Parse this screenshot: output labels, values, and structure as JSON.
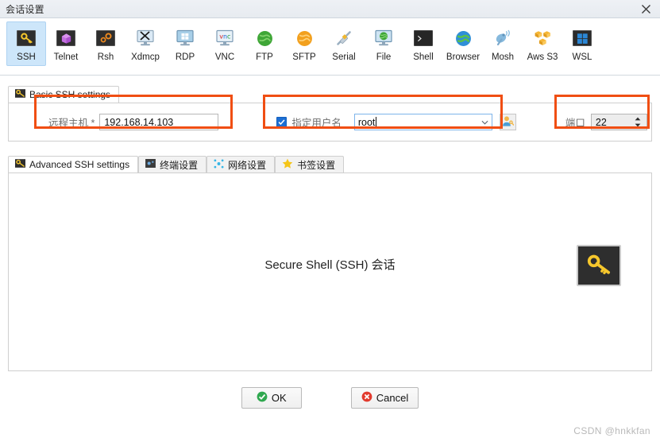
{
  "window": {
    "title": "会话设置",
    "close_icon": "close-icon"
  },
  "toolbar": {
    "items": [
      {
        "label": "SSH",
        "icon": "key-icon",
        "selected": true
      },
      {
        "label": "Telnet",
        "icon": "purple-cube-icon",
        "selected": false
      },
      {
        "label": "Rsh",
        "icon": "orange-gears-icon",
        "selected": false
      },
      {
        "label": "Xdmcp",
        "icon": "monitor-x-icon",
        "selected": false
      },
      {
        "label": "RDP",
        "icon": "monitor-windows-icon",
        "selected": false
      },
      {
        "label": "VNC",
        "icon": "monitor-vnc-icon",
        "selected": false
      },
      {
        "label": "FTP",
        "icon": "green-globe-icon",
        "selected": false
      },
      {
        "label": "SFTP",
        "icon": "orange-globe-icon",
        "selected": false
      },
      {
        "label": "Serial",
        "icon": "serial-cable-icon",
        "selected": false
      },
      {
        "label": "File",
        "icon": "monitor-globe-icon",
        "selected": false
      },
      {
        "label": "Shell",
        "icon": "terminal-icon",
        "selected": false
      },
      {
        "label": "Browser",
        "icon": "blue-globe-icon",
        "selected": false
      },
      {
        "label": "Mosh",
        "icon": "satellite-dish-icon",
        "selected": false
      },
      {
        "label": "Aws S3",
        "icon": "aws-cubes-icon",
        "selected": false
      },
      {
        "label": "WSL",
        "icon": "windows-logo-icon",
        "selected": false
      }
    ]
  },
  "basic": {
    "tab_label": "Basic SSH settings",
    "tab_icon": "key-icon",
    "host_label": "远程主机 *",
    "host_value": "192.168.14.103",
    "username_label": "指定用户名",
    "username_checked": true,
    "username_value": "root",
    "username_browse_icon": "user-key-icon",
    "port_label": "端口",
    "port_value": "22"
  },
  "advanced": {
    "tabs": [
      {
        "label": "Advanced SSH settings",
        "icon": "key-icon",
        "active": true
      },
      {
        "label": "终端设置",
        "icon": "terminal-blue-icon",
        "active": false
      },
      {
        "label": "网络设置",
        "icon": "network-dots-icon",
        "active": false
      },
      {
        "label": "书签设置",
        "icon": "star-icon",
        "active": false
      }
    ],
    "body_text": "Secure Shell (SSH) 会话",
    "body_icon": "key-icon"
  },
  "footer": {
    "ok_label": "OK",
    "ok_icon": "check-circle-icon",
    "cancel_label": "Cancel",
    "cancel_icon": "x-circle-icon"
  },
  "watermark": "CSDN @hnkkfan",
  "colors": {
    "accent": "#1d6fd4",
    "annotation": "#f04e13",
    "selected_tool_bg": "#cde6fa",
    "ok_green": "#2fa84f",
    "cancel_red": "#e23b2e"
  }
}
